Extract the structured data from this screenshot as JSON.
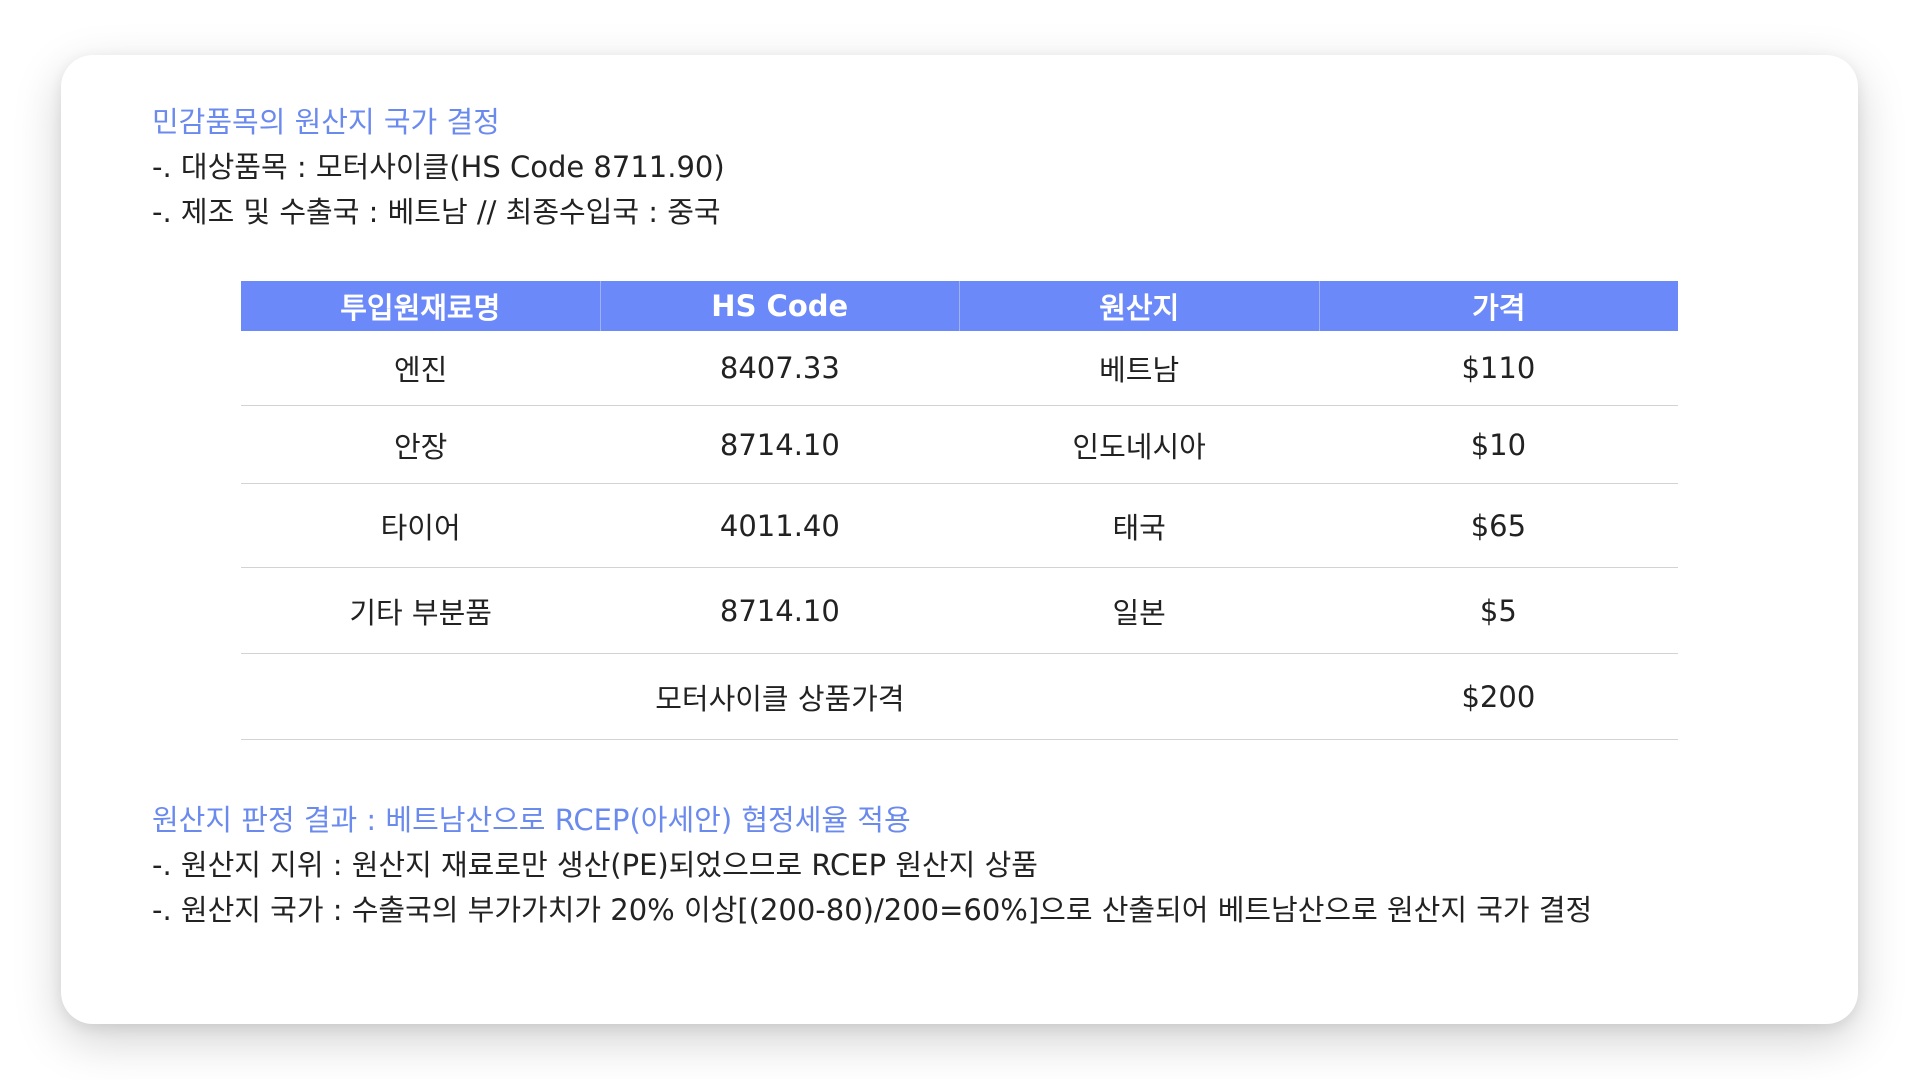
{
  "header": {
    "title": "민감품목의 원산지 국가 결정",
    "item_line": "-. 대상품목 : 모터사이클(HS Code 8711.90)",
    "country_line": "-. 제조 및 수출국 : 베트남 // 최종수입국 : 중국"
  },
  "table": {
    "columns": [
      "투입원재료명",
      "HS Code",
      "원산지",
      "가격"
    ],
    "rows": [
      {
        "material": "엔진",
        "hs_code": "8407.33",
        "origin": "베트남",
        "price": "$110"
      },
      {
        "material": "안장",
        "hs_code": "8714.10",
        "origin": "인도네시아",
        "price": "$10"
      },
      {
        "material": "타이어",
        "hs_code": "4011.40",
        "origin": "태국",
        "price": "$65"
      },
      {
        "material": "기타 부분품",
        "hs_code": "8714.10",
        "origin": "일본",
        "price": "$5"
      }
    ],
    "total": {
      "label": "모터사이클 상품가격",
      "price": "$200"
    }
  },
  "result": {
    "title": "원산지 판정 결과 : 베트남산으로 RCEP(아세안) 협정세율 적용",
    "status_line": "-. 원산지 지위 : 원산지 재료로만 생산(PE)되었으므로 RCEP 원산지 상품",
    "country_line": "-. 원산지 국가 : 수출국의 부가가치가 20% 이상[(200-80)/200=60%]으로 산출되어 베트남산으로 원산지 국가 결정"
  },
  "colors": {
    "accent": "#6b8aee",
    "table_header": "#6b89f8",
    "text": "#222222"
  }
}
